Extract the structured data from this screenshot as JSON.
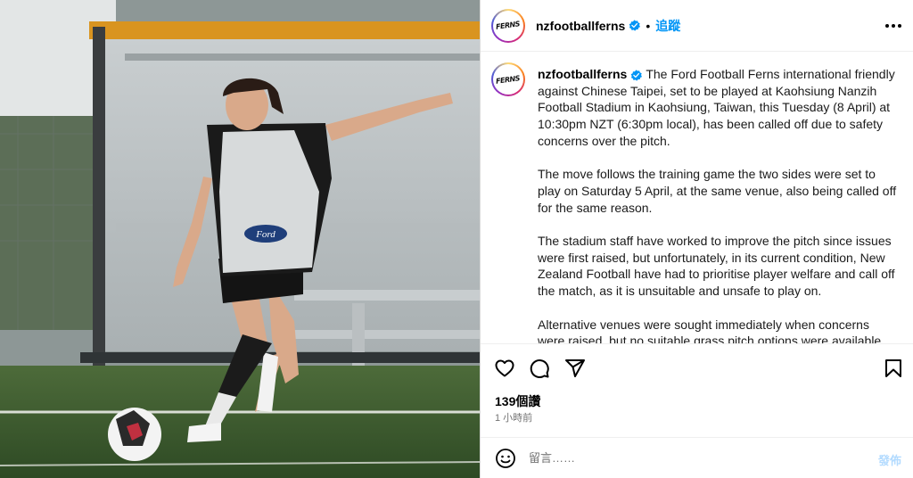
{
  "account": {
    "username": "nzfootballferns",
    "logo_text": "FERNS",
    "follow_label": "追蹤",
    "separator": "•"
  },
  "caption": {
    "paragraphs": [
      "The Ford Football Ferns international friendly against Chinese Taipei, set to be played at Kaohsiung Nanzih Football Stadium in Kaohsiung, Taiwan, this Tuesday (8 April) at 10:30pm NZT (6:30pm local), has been called off due to safety concerns over the pitch.",
      "The move follows the training game the two sides were set to play on Saturday 5 April, at the same venue, also being called off for the same reason.",
      "The stadium staff have worked to improve the pitch since issues were first raised, but unfortunately, in its current condition, New Zealand Football have had to prioritise player welfare and call off the match, as it is unsuitable and unsafe to play on.",
      "Alternative venues were sought immediately when concerns were raised, but no suitable grass pitch options were available, so"
    ]
  },
  "photo": {
    "sponsor_text": "Ford"
  },
  "stats": {
    "likes": "139個讚",
    "time_ago": "1 小時前"
  },
  "comment": {
    "placeholder": "留言……",
    "post_label": "發佈"
  },
  "icons": {
    "like": "heart-icon",
    "comment": "comment-icon",
    "share": "share-icon",
    "save": "bookmark-icon",
    "emoji": "emoji-icon",
    "more": "more-options-icon",
    "verified": "verified-badge-icon"
  },
  "colors": {
    "follow": "#0095f6",
    "verified": "#0095f6",
    "post_disabled": "#b3dbff",
    "secondary_text": "#737373"
  }
}
